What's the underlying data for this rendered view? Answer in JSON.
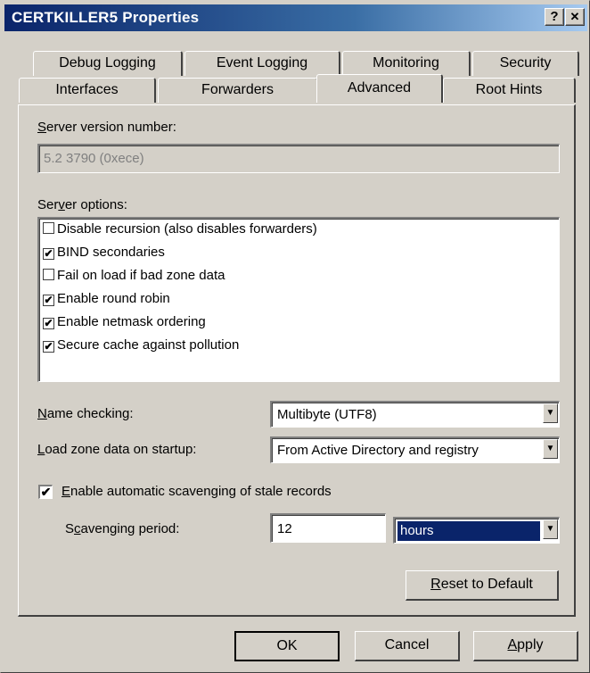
{
  "window": {
    "title": "CERTKILLER5 Properties",
    "help_button": "?",
    "close_button": "✕"
  },
  "tabs_row_back": [
    "Debug Logging",
    "Event Logging",
    "Monitoring",
    "Security"
  ],
  "tabs_row_front": [
    "Interfaces",
    "Forwarders",
    "Advanced",
    "Root Hints"
  ],
  "active_tab": "Advanced",
  "server_version": {
    "label_pre": "",
    "label_u": "S",
    "label_post": "erver version number:",
    "value": "5.2 3790 (0xece)"
  },
  "server_options": {
    "label_pre": "Ser",
    "label_u": "v",
    "label_post": "er options:",
    "items": [
      {
        "label": "Disable recursion (also disables forwarders)",
        "checked": false,
        "mark": ""
      },
      {
        "label": "BIND secondaries",
        "checked": true,
        "mark": "✔"
      },
      {
        "label": "Fail on load if bad zone data",
        "checked": false,
        "mark": ""
      },
      {
        "label": "Enable round robin",
        "checked": true,
        "mark": "✔"
      },
      {
        "label": "Enable netmask ordering",
        "checked": true,
        "mark": "✔"
      },
      {
        "label": "Secure cache against pollution",
        "checked": true,
        "mark": "✔"
      }
    ]
  },
  "name_checking": {
    "label_pre": "",
    "label_u": "N",
    "label_post": "ame checking:",
    "value": "Multibyte (UTF8)"
  },
  "load_zone": {
    "label_pre": "",
    "label_u": "L",
    "label_post": "oad zone data on startup:",
    "value": "From Active Directory and registry"
  },
  "scavenging": {
    "enable_mark": "✔",
    "enable_label_pre": "",
    "enable_label_u": "E",
    "enable_label_post": "nable automatic scavenging of stale records",
    "period_label_pre": "S",
    "period_label_u": "c",
    "period_label_post": "avenging period:",
    "period_value": "12",
    "unit_value": "hours"
  },
  "buttons": {
    "reset_pre": "",
    "reset_u": "R",
    "reset_post": "eset to Default",
    "ok": "OK",
    "cancel": "Cancel",
    "apply_pre": "",
    "apply_u": "A",
    "apply_post": "pply"
  },
  "arrow_glyph": "▼",
  "colors": {
    "title_start": "#0a246a",
    "title_end": "#a6caf0",
    "selection": "#0a246a",
    "face": "#d4d0c8"
  }
}
